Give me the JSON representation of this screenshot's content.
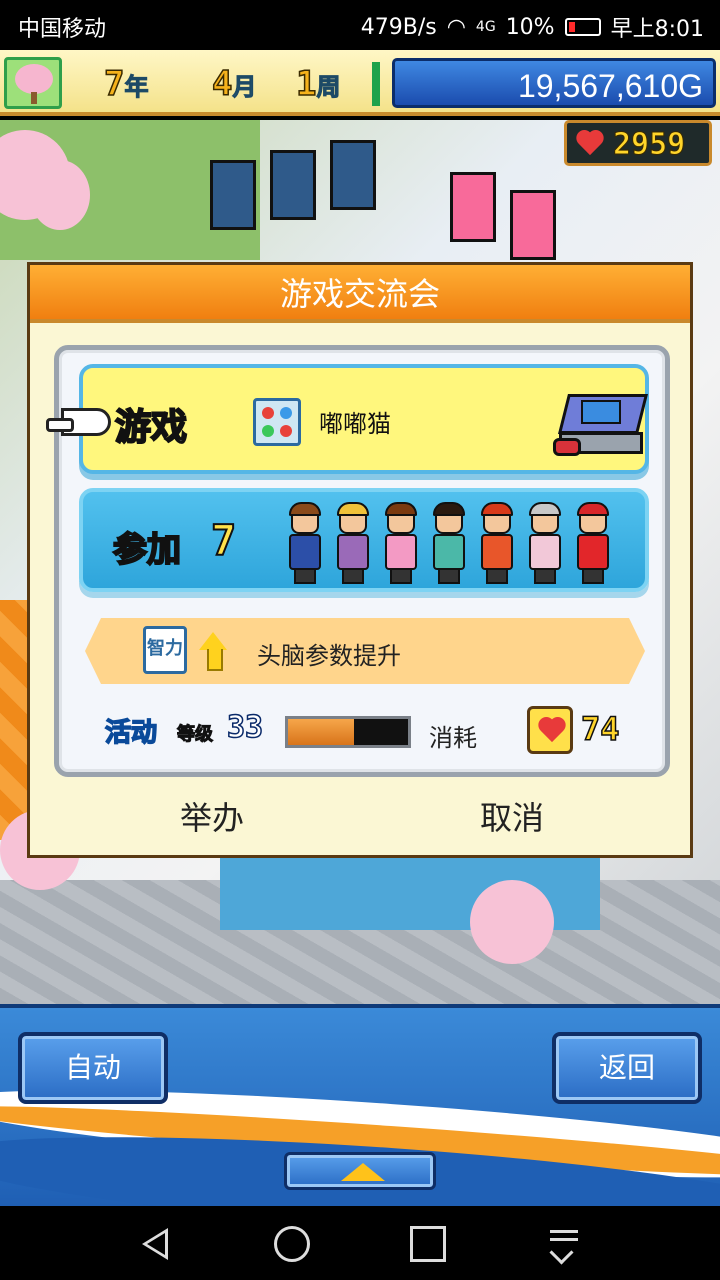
{
  "status_bar": {
    "carrier": "中国移动",
    "network_speed": "479B/s",
    "network_type": "4G",
    "battery": "10%",
    "time": "早上8:01"
  },
  "hud": {
    "year": "7",
    "year_unit": "年",
    "month": "4",
    "month_unit": "月",
    "week": "1",
    "week_unit": "周",
    "money": "19,567,610G",
    "hearts": "2959"
  },
  "dialog": {
    "title": "游戏交流会",
    "game_label": "游戏",
    "game_name": "嘟嘟猫",
    "join_label": "参加",
    "join_count": "7",
    "effect_icon_text": "智力",
    "effect_text": "头脑参数提升",
    "activity_label": "活动",
    "level_label": "等级",
    "level": "33",
    "level_progress_percent": 55,
    "cost_label": "消耗",
    "cost": "74",
    "host_button": "举办",
    "cancel_button": "取消"
  },
  "participants": [
    {
      "name": "participant-1",
      "hair": "#8a4a1a",
      "outfit": "#2c4fa8"
    },
    {
      "name": "participant-2",
      "hair": "#f0c23a",
      "outfit": "#9a6ab8"
    },
    {
      "name": "participant-3",
      "hair": "#7a3a10",
      "outfit": "#f39ac4"
    },
    {
      "name": "participant-4",
      "hair": "#2a1a10",
      "outfit": "#4bb8a8"
    },
    {
      "name": "participant-5",
      "hair": "#d83a1a",
      "outfit": "#e8562a"
    },
    {
      "name": "participant-6",
      "hair": "#c8c8c8",
      "outfit": "#f2c8d8"
    },
    {
      "name": "participant-7",
      "hair": "#d8262a",
      "outfit": "#e2262a"
    }
  ],
  "bottom_panel": {
    "auto_button": "自动",
    "back_button": "返回"
  },
  "colors": {
    "dialog_title_bg": "#f07f10",
    "game_row_bg": "#fff77d",
    "participants_row_bg": "#2ea5db",
    "effect_row_bg": "#ffd58c",
    "heart": "#e83a3a"
  }
}
